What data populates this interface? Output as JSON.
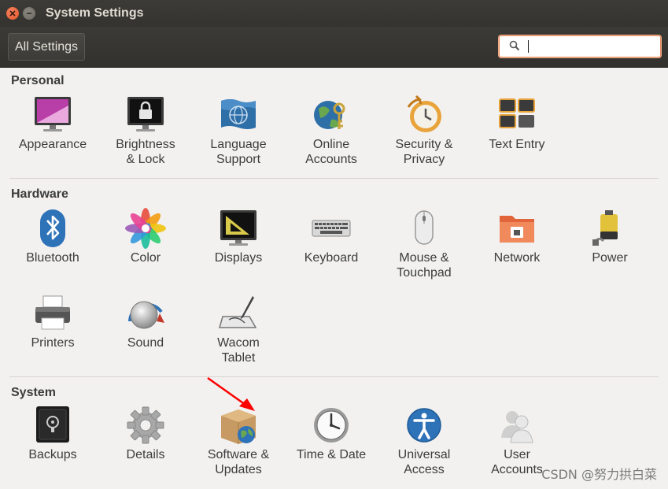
{
  "window": {
    "title": "System Settings"
  },
  "toolbar": {
    "all_settings_label": "All Settings",
    "search_value": "",
    "search_placeholder": ""
  },
  "sections": [
    {
      "title": "Personal",
      "items": [
        {
          "label": [
            "Appearance"
          ],
          "icon": "appearance-icon"
        },
        {
          "label": [
            "Brightness",
            "& Lock"
          ],
          "icon": "brightness-lock-icon"
        },
        {
          "label": [
            "Language",
            "Support"
          ],
          "icon": "language-support-icon"
        },
        {
          "label": [
            "Online",
            "Accounts"
          ],
          "icon": "online-accounts-icon"
        },
        {
          "label": [
            "Security &",
            "Privacy"
          ],
          "icon": "security-privacy-icon"
        },
        {
          "label": [
            "Text Entry"
          ],
          "icon": "text-entry-icon"
        }
      ]
    },
    {
      "title": "Hardware",
      "items": [
        {
          "label": [
            "Bluetooth"
          ],
          "icon": "bluetooth-icon"
        },
        {
          "label": [
            "Color"
          ],
          "icon": "color-icon"
        },
        {
          "label": [
            "Displays"
          ],
          "icon": "displays-icon"
        },
        {
          "label": [
            "Keyboard"
          ],
          "icon": "keyboard-icon"
        },
        {
          "label": [
            "Mouse &",
            "Touchpad"
          ],
          "icon": "mouse-touchpad-icon"
        },
        {
          "label": [
            "Network"
          ],
          "icon": "network-icon"
        },
        {
          "label": [
            "Power"
          ],
          "icon": "power-icon"
        },
        {
          "label": [
            "Printers"
          ],
          "icon": "printers-icon"
        },
        {
          "label": [
            "Sound"
          ],
          "icon": "sound-icon"
        },
        {
          "label": [
            "Wacom",
            "Tablet"
          ],
          "icon": "wacom-tablet-icon"
        }
      ]
    },
    {
      "title": "System",
      "items": [
        {
          "label": [
            "Backups"
          ],
          "icon": "backups-icon"
        },
        {
          "label": [
            "Details"
          ],
          "icon": "details-icon"
        },
        {
          "label": [
            "Software &",
            "Updates"
          ],
          "icon": "software-updates-icon"
        },
        {
          "label": [
            "Time & Date"
          ],
          "icon": "time-date-icon"
        },
        {
          "label": [
            "Universal",
            "Access"
          ],
          "icon": "universal-access-icon"
        },
        {
          "label": [
            "User",
            "Accounts"
          ],
          "icon": "user-accounts-icon"
        }
      ]
    }
  ],
  "watermark": "CSDN @努力拱白菜",
  "colors": {
    "titlebar": "#3c3b37",
    "accent": "#e95420",
    "arrow": "#ff0000"
  }
}
